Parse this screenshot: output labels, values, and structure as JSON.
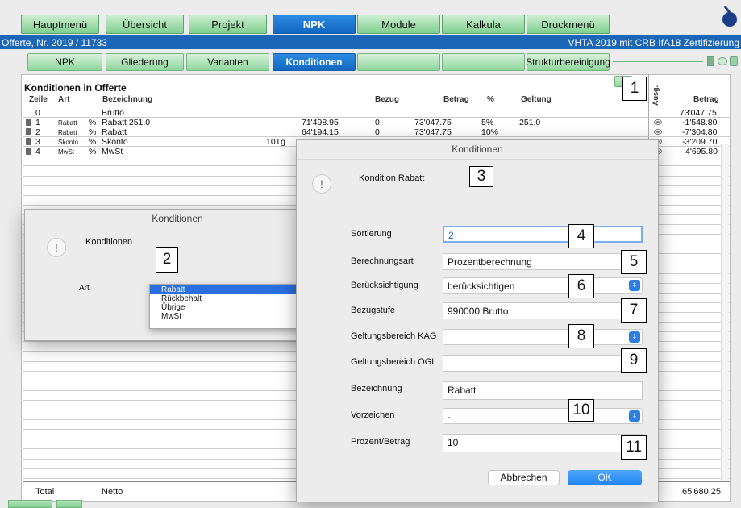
{
  "main_tabs": [
    {
      "label": "Hauptmenü"
    },
    {
      "label": "Übersicht"
    },
    {
      "label": "Projekt"
    },
    {
      "label": "NPK"
    },
    {
      "label": "Module"
    },
    {
      "label": "Kalkula"
    },
    {
      "label": "Druckmenü"
    }
  ],
  "status_bar": {
    "left": "Offerte, Nr. 2019 / 11733",
    "right": "VHTA 2019 mit CRB IfA18 Zertifizierung"
  },
  "sub_tabs": [
    {
      "label": "NPK"
    },
    {
      "label": "Gliederung"
    },
    {
      "label": "Varianten"
    },
    {
      "label": "Konditionen"
    },
    {
      "label": ""
    },
    {
      "label": ""
    },
    {
      "label": "Strukturbereinigung"
    }
  ],
  "section_title": "Konditionen in Offerte",
  "table": {
    "headers": {
      "zeile": "Zeile",
      "art": "Art",
      "bezeichnung": "Bezeichnung",
      "bezug": "Bezug",
      "betrag": "Betrag",
      "percent": "%",
      "geltung": "Geltung",
      "ausg": "Ausg.",
      "betrag_right": "Betrag"
    },
    "brutto_row": {
      "zeile": "0",
      "bezeichnung": "Brutto",
      "betrag_right": "73'047.75"
    },
    "rows": [
      {
        "zeile": "1",
        "art": "Rabatt",
        "sign": "%",
        "bezeichnung": "Rabatt 251.0",
        "extra": "",
        "amount": "71'498.95",
        "bezug": "0",
        "betrag": "73'047.75",
        "percent": "5%",
        "geltung": "251.0",
        "betrag_right": "-1'548.80"
      },
      {
        "zeile": "2",
        "art": "Rabatt",
        "sign": "%",
        "bezeichnung": "Rabatt",
        "extra": "",
        "amount": "64'194.15",
        "bezug": "0",
        "betrag": "73'047.75",
        "percent": "10%",
        "geltung": "",
        "betrag_right": "-7'304.80"
      },
      {
        "zeile": "3",
        "art": "Skonto",
        "sign": "%",
        "bezeichnung": "Skonto",
        "extra": "10Tg",
        "amount": "",
        "bezug": "",
        "betrag": "",
        "percent": "",
        "geltung": "",
        "betrag_right": "-3'209.70"
      },
      {
        "zeile": "4",
        "art": "MwSt",
        "sign": "%",
        "bezeichnung": "MwSt",
        "extra": "",
        "amount": "",
        "bezug": "",
        "betrag": "",
        "percent": "",
        "geltung": "",
        "betrag_right": "4'695.80"
      }
    ],
    "footer": {
      "label": "Total",
      "bezeichnung": "Netto",
      "betrag_right": "65'680.25"
    }
  },
  "dialog_small": {
    "title": "Konditionen",
    "heading": "Konditionen",
    "art_label": "Art",
    "dropdown_options": [
      "Rabatt",
      "Rückbehalt",
      "Übrige",
      "MwSt"
    ],
    "selected": "Rabatt"
  },
  "dialog_main": {
    "title": "Konditionen",
    "heading": "Kondition Rabatt",
    "fields": {
      "sortierung": {
        "label": "Sortierung",
        "value": "2"
      },
      "berechnungsart": {
        "label": "Berechnungsart",
        "value": "Prozentberechnung"
      },
      "beruecksichtigung": {
        "label": "Berücksichtigung",
        "value": "berücksichtigen"
      },
      "bezugstufe": {
        "label": "Bezugstufe",
        "value": "990000 Brutto"
      },
      "geltung_kag": {
        "label": "Geltungsbereich KAG",
        "value": ""
      },
      "geltung_ogl": {
        "label": "Geltungsbereich OGL",
        "value": ""
      },
      "bezeichnung": {
        "label": "Bezeichnung",
        "value": "Rabatt"
      },
      "vorzeichen": {
        "label": "Vorzeichen",
        "value": "-"
      },
      "prozent": {
        "label": "Prozent/Betrag",
        "value": "10"
      }
    },
    "cancel": "Abbrechen",
    "ok": "OK"
  },
  "callouts": [
    "1",
    "2",
    "3",
    "4",
    "5",
    "6",
    "7",
    "8",
    "9",
    "10",
    "11"
  ],
  "colors": {
    "green_tab": "#8fd59c",
    "blue_accent": "#1b66b7",
    "ok_button": "#2a8cf0"
  }
}
